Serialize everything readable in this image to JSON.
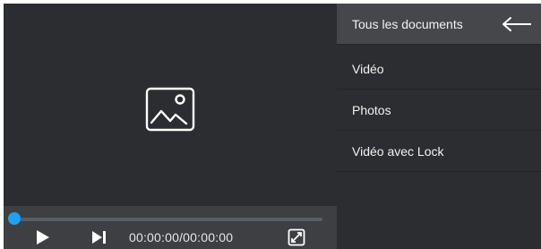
{
  "player": {
    "time_display": "00:00:00/00:00:00",
    "progress": 0,
    "accent_color": "#1da1f2",
    "icons": {
      "placeholder": "image-placeholder-icon",
      "play": "play-icon",
      "next": "skip-next-icon",
      "fullscreen": "fullscreen-icon"
    }
  },
  "sidebar": {
    "back_icon": "back-arrow-icon",
    "items": [
      {
        "label": "Tous les documents",
        "active": true
      },
      {
        "label": "Vidéo",
        "active": false
      },
      {
        "label": "Photos",
        "active": false
      },
      {
        "label": "Vidéo avec Lock",
        "active": false
      }
    ]
  }
}
